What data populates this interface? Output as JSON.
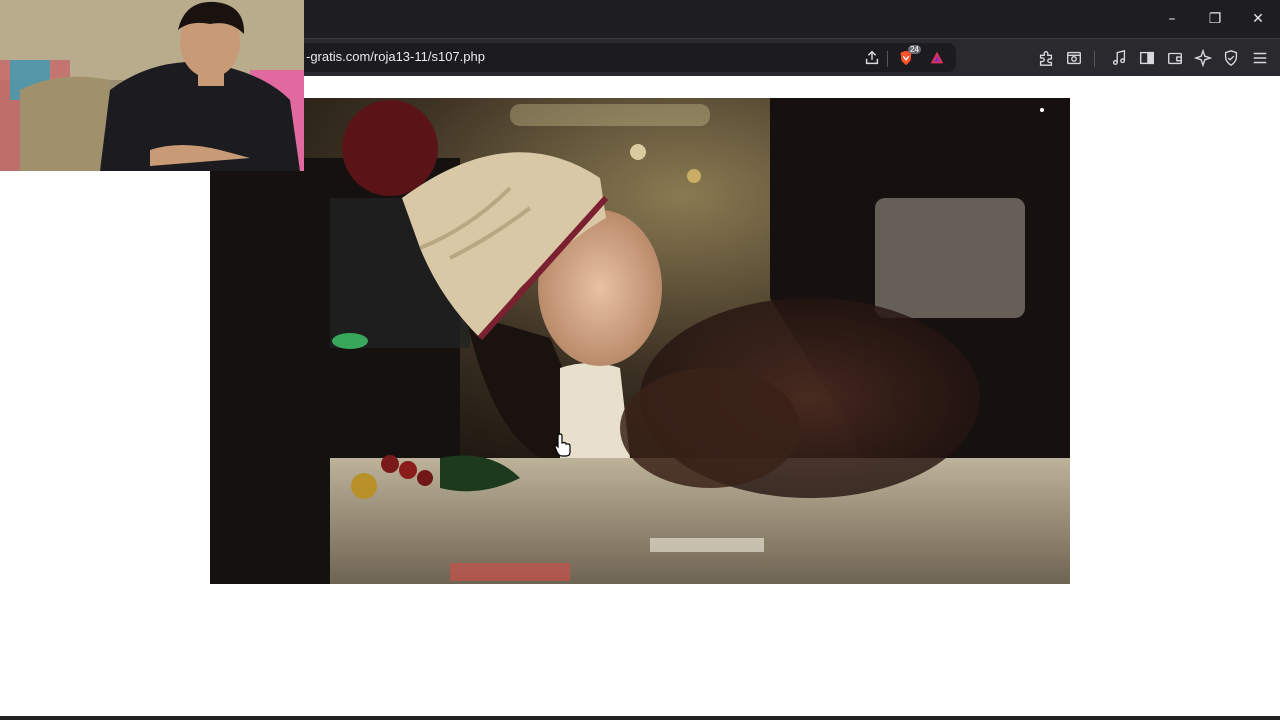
{
  "browser": {
    "url_visible": "-gratis.com/roja13-11/s107.php",
    "shield_badge": "24",
    "window_controls": {
      "minimize": "–",
      "restore": "❐",
      "close": "✕"
    },
    "toolbar_icons": [
      "share-icon",
      "brave-shield-icon",
      "brave-rewards-icon",
      "extensions-icon",
      "screenshot-icon",
      "media-icon",
      "sidebar-icon",
      "wallet-icon",
      "leo-ai-icon",
      "vpn-icon",
      "menu-icon"
    ]
  },
  "colors": {
    "titlebar": "#1e1e22",
    "toolbar": "#2a2a2e",
    "urlbar": "#1c1c20",
    "brave_orange": "#fb542b",
    "rewards_red": "#e0315b"
  },
  "video": {
    "description_icon": "video-player"
  },
  "webcam": {
    "description_icon": "webcam-overlay"
  }
}
